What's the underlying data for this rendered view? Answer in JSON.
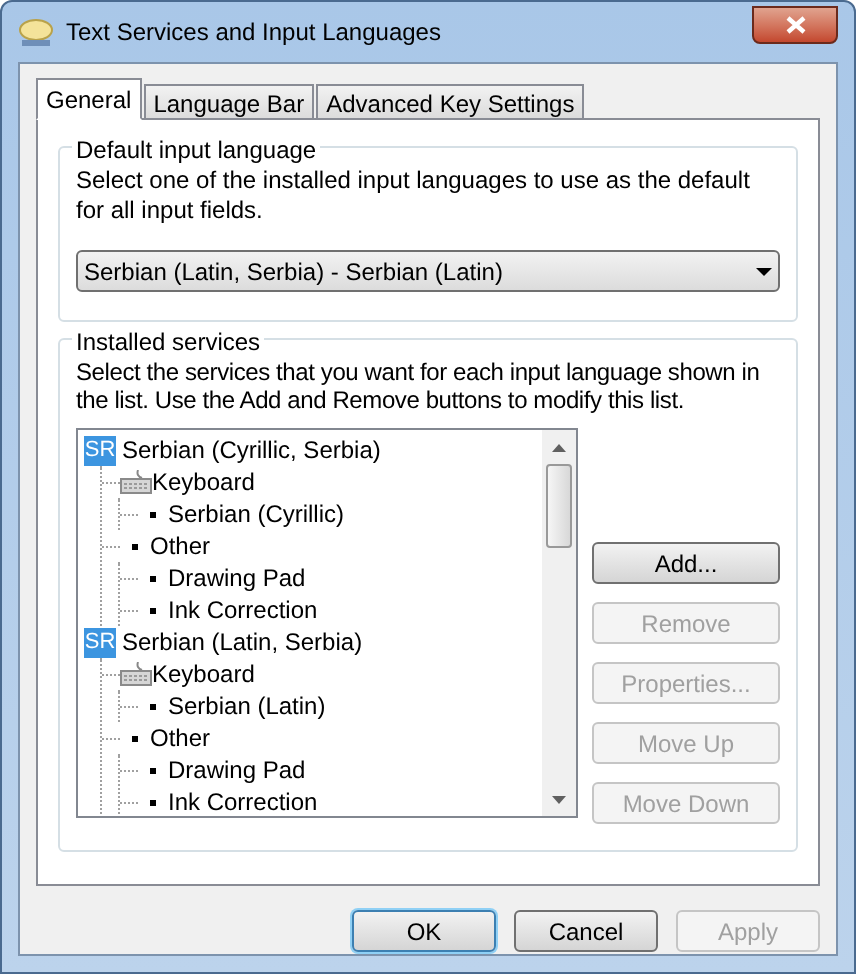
{
  "window": {
    "title": "Text Services and Input Languages"
  },
  "tabs": [
    {
      "label": "General",
      "selected": true
    },
    {
      "label": "Language Bar",
      "selected": false
    },
    {
      "label": "Advanced Key Settings",
      "selected": false
    }
  ],
  "default_input_language": {
    "title": "Default input language",
    "description": "Select one of the installed input languages to use as the default for all input fields.",
    "value": "Serbian (Latin, Serbia) - Serbian (Latin)"
  },
  "installed_services": {
    "title": "Installed services",
    "description": "Select the services that you want for each input language shown in the list. Use the Add and Remove buttons to modify this list.",
    "tree": [
      {
        "kind": "language",
        "badge": "SR",
        "label": "Serbian (Cyrillic, Serbia)",
        "children": [
          {
            "kind": "keyboard",
            "label": "Keyboard",
            "children": [
              {
                "kind": "item",
                "label": "Serbian (Cyrillic)"
              }
            ]
          },
          {
            "kind": "item",
            "label": "Other",
            "children": [
              {
                "kind": "item",
                "label": "Drawing Pad"
              },
              {
                "kind": "item",
                "label": "Ink Correction"
              }
            ]
          }
        ]
      },
      {
        "kind": "language",
        "badge": "SR",
        "label": "Serbian (Latin, Serbia)",
        "children": [
          {
            "kind": "keyboard",
            "label": "Keyboard",
            "children": [
              {
                "kind": "item",
                "label": "Serbian (Latin)"
              }
            ]
          },
          {
            "kind": "item",
            "label": "Other",
            "children": [
              {
                "kind": "item",
                "label": "Drawing Pad"
              },
              {
                "kind": "item",
                "label": "Ink Correction"
              }
            ]
          }
        ]
      }
    ],
    "buttons": [
      {
        "label": "Add...",
        "disabled": false
      },
      {
        "label": "Remove",
        "disabled": true
      },
      {
        "label": "Properties...",
        "disabled": true
      },
      {
        "label": "Move Up",
        "disabled": true
      },
      {
        "label": "Move Down",
        "disabled": true
      }
    ]
  },
  "dialog_buttons": [
    {
      "label": "OK",
      "disabled": false,
      "default": true
    },
    {
      "label": "Cancel",
      "disabled": false,
      "default": false
    },
    {
      "label": "Apply",
      "disabled": true,
      "default": false
    }
  ]
}
